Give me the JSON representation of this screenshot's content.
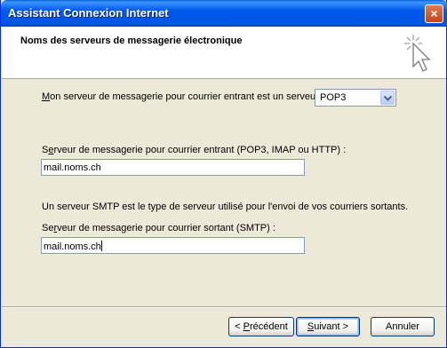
{
  "window": {
    "title": "Assistant Connexion Internet",
    "close_glyph": "×"
  },
  "header": {
    "title": "Noms des serveurs de messagerie électronique",
    "icon": "wizard-sparkle-icon"
  },
  "incoming_type": {
    "label_accel": "M",
    "label_rest": "on serveur de messagerie pour courrier entrant est un serveur",
    "value": "POP3"
  },
  "incoming_server": {
    "label_pre": "S",
    "label_accel": "e",
    "label_rest": "rveur de messagerie pour courrier entrant (POP3, IMAP ou HTTP) :",
    "value": "mail.noms.ch"
  },
  "smtp_info": "Un serveur SMTP est le type de serveur utilisé pour l'envoi de vos courriers sortants.",
  "outgoing_server": {
    "label_pre": "Se",
    "label_accel": "r",
    "label_rest": "veur de messagerie pour courrier sortant (SMTP) :",
    "value": "mail.noms.ch"
  },
  "buttons": {
    "back_pre": "< ",
    "back_accel": "P",
    "back_rest": "récédent",
    "next_accel": "S",
    "next_rest": "uivant >",
    "cancel": "Annuler"
  }
}
